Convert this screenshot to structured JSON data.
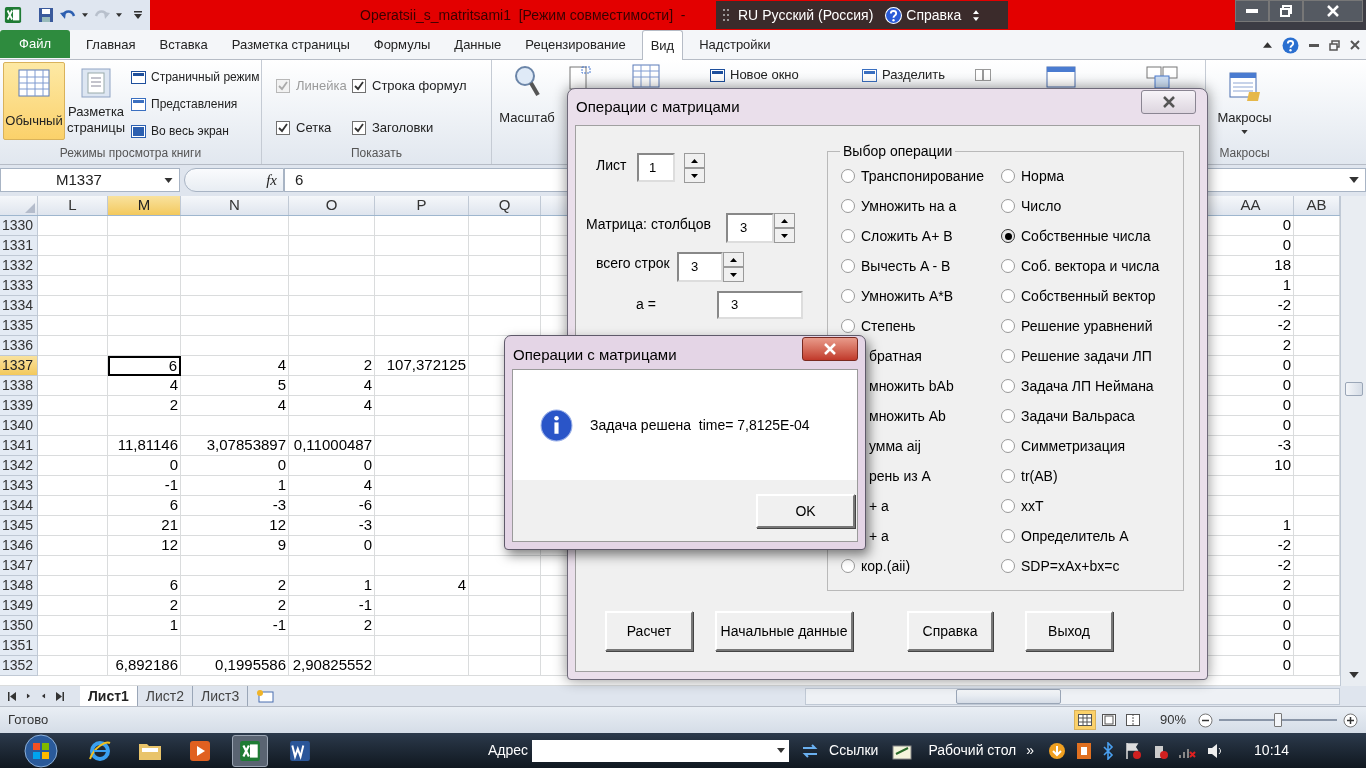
{
  "title_bar": {
    "title": "Operatsii_s_matritsami1  [Режим совместимости]  -",
    "language_bar": {
      "code": "RU",
      "language": "Русский (Россия)",
      "help": "Справка"
    }
  },
  "ribbon_tabs": [
    {
      "label": "Файл",
      "selected": false,
      "kind": "file"
    },
    {
      "label": "Главная",
      "selected": false,
      "kind": "tab"
    },
    {
      "label": "Вставка",
      "selected": false,
      "kind": "tab"
    },
    {
      "label": "Разметка страницы",
      "selected": false,
      "kind": "tab"
    },
    {
      "label": "Формулы",
      "selected": false,
      "kind": "tab"
    },
    {
      "label": "Данные",
      "selected": false,
      "kind": "tab"
    },
    {
      "label": "Рецензирование",
      "selected": false,
      "kind": "tab"
    },
    {
      "label": "Вид",
      "selected": true,
      "kind": "tab"
    },
    {
      "label": "Надстройки",
      "selected": false,
      "kind": "tab"
    }
  ],
  "ribbon": {
    "view_modes": {
      "caption": "Режимы просмотра книги",
      "large": [
        {
          "label": "Обычный",
          "selected": true
        },
        {
          "label": "Разметка страницы",
          "selected": false
        }
      ],
      "small": [
        "Страничный режим",
        "Представления",
        "Во весь экран"
      ]
    },
    "show": {
      "caption": "Показать",
      "checks": [
        {
          "label": "Линейка",
          "checked": true,
          "disabled": true
        },
        {
          "label": "Строка формул",
          "checked": true,
          "disabled": false
        },
        {
          "label": "Сетка",
          "checked": true,
          "disabled": false
        },
        {
          "label": "Заголовки",
          "checked": true,
          "disabled": false
        }
      ]
    },
    "zoom": {
      "label": "Масштаб"
    },
    "window": {
      "small": [
        "Новое окно",
        "Разделить"
      ]
    },
    "macros": {
      "label": "Макросы",
      "caption": "Макросы"
    }
  },
  "formula_bar": {
    "name_box": "M1337",
    "function_label": "fx",
    "value": "6"
  },
  "sheet": {
    "columns": [
      {
        "label": "L",
        "selected": false
      },
      {
        "label": "M",
        "selected": true
      },
      {
        "label": "N",
        "selected": false
      },
      {
        "label": "O",
        "selected": false
      },
      {
        "label": "P",
        "selected": false
      },
      {
        "label": "Q",
        "selected": false
      },
      {
        "label": "AA",
        "selected": false
      },
      {
        "label": "AB",
        "selected": false
      }
    ],
    "rows": [
      {
        "number": "1330",
        "selected": false,
        "cells": [
          null,
          null,
          null,
          null,
          null,
          null,
          "0",
          null
        ]
      },
      {
        "number": "1331",
        "selected": false,
        "cells": [
          null,
          null,
          null,
          null,
          null,
          null,
          "0",
          null
        ]
      },
      {
        "number": "1332",
        "selected": false,
        "cells": [
          null,
          null,
          null,
          null,
          null,
          null,
          "18",
          null
        ]
      },
      {
        "number": "1333",
        "selected": false,
        "cells": [
          null,
          null,
          null,
          null,
          null,
          null,
          "1",
          null
        ]
      },
      {
        "number": "1334",
        "selected": false,
        "cells": [
          null,
          null,
          null,
          null,
          null,
          null,
          "-2",
          null
        ]
      },
      {
        "number": "1335",
        "selected": false,
        "cells": [
          null,
          null,
          null,
          null,
          null,
          null,
          "-2",
          null
        ]
      },
      {
        "number": "1336",
        "selected": false,
        "cells": [
          null,
          null,
          null,
          null,
          null,
          null,
          "2",
          null
        ]
      },
      {
        "number": "1337",
        "selected": true,
        "cells": [
          null,
          "6",
          "4",
          "2",
          "107,372125",
          null,
          "0",
          null
        ]
      },
      {
        "number": "1338",
        "selected": false,
        "cells": [
          null,
          "4",
          "5",
          "4",
          null,
          null,
          "0",
          null
        ]
      },
      {
        "number": "1339",
        "selected": false,
        "cells": [
          null,
          "2",
          "4",
          "4",
          null,
          null,
          "0",
          null
        ]
      },
      {
        "number": "1340",
        "selected": false,
        "cells": [
          null,
          null,
          null,
          null,
          null,
          null,
          "0",
          null
        ]
      },
      {
        "number": "1341",
        "selected": false,
        "cells": [
          null,
          "11,81146",
          "3,07853897",
          "0,11000487",
          null,
          null,
          "-3",
          null
        ]
      },
      {
        "number": "1342",
        "selected": false,
        "cells": [
          null,
          "0",
          "0",
          "0",
          null,
          null,
          "10",
          null
        ]
      },
      {
        "number": "1343",
        "selected": false,
        "cells": [
          null,
          "-1",
          "1",
          "4",
          null,
          null,
          null,
          null
        ]
      },
      {
        "number": "1344",
        "selected": false,
        "cells": [
          null,
          "6",
          "-3",
          "-6",
          null,
          null,
          null,
          null
        ]
      },
      {
        "number": "1345",
        "selected": false,
        "cells": [
          null,
          "21",
          "12",
          "-3",
          null,
          null,
          "1",
          null
        ]
      },
      {
        "number": "1346",
        "selected": false,
        "cells": [
          null,
          "12",
          "9",
          "0",
          null,
          null,
          "-2",
          null
        ]
      },
      {
        "number": "1347",
        "selected": false,
        "cells": [
          null,
          null,
          null,
          null,
          null,
          null,
          "-2",
          null
        ]
      },
      {
        "number": "1348",
        "selected": false,
        "cells": [
          null,
          "6",
          "2",
          "1",
          "4",
          null,
          "2",
          null
        ]
      },
      {
        "number": "1349",
        "selected": false,
        "cells": [
          null,
          "2",
          "2",
          "-1",
          null,
          null,
          "0",
          null
        ]
      },
      {
        "number": "1350",
        "selected": false,
        "cells": [
          null,
          "1",
          "-1",
          "2",
          null,
          null,
          "0",
          null
        ]
      },
      {
        "number": "1351",
        "selected": false,
        "cells": [
          null,
          null,
          null,
          null,
          null,
          null,
          "0",
          null
        ]
      },
      {
        "number": "1352",
        "selected": false,
        "cells": [
          null,
          "6,892186",
          "0,1995586",
          "2,90825552",
          null,
          null,
          "0",
          null
        ]
      }
    ]
  },
  "sheet_tabs": [
    {
      "label": "Лист1",
      "selected": true
    },
    {
      "label": "Лист2",
      "selected": false
    },
    {
      "label": "Лист3",
      "selected": false
    }
  ],
  "status_bar": {
    "text": "Готово",
    "view_buttons": [
      {
        "selected": true
      },
      {
        "selected": false
      },
      {
        "selected": false
      }
    ],
    "zoom": "90%",
    "zoom_slider": {
      "level": 0.5
    }
  },
  "dialog": {
    "title": "Операции с матрицами",
    "sheet": {
      "label": "Лист",
      "value": "1"
    },
    "columns": {
      "label": "Матрица: столбцов",
      "value": "3"
    },
    "rows": {
      "label": "всего строк",
      "value": "3"
    },
    "scalar": {
      "label": "a =",
      "value": "3"
    },
    "operations": {
      "title": "Выбор операции",
      "columns": [
        [
          {
            "kind": "radio",
            "label": "Транспонирование",
            "selected": false
          },
          {
            "kind": "radio",
            "label": "Умножить на a",
            "selected": false
          },
          {
            "kind": "radio",
            "label": "Сложить A+ B",
            "selected": false
          },
          {
            "kind": "radio",
            "label": "Вычесть A - B",
            "selected": false
          },
          {
            "kind": "radio",
            "label": "Умножить A*B",
            "selected": false
          },
          {
            "kind": "radio",
            "label": "Степень",
            "selected": false
          },
          {
            "kind": "text",
            "label": "братная"
          },
          {
            "kind": "text",
            "label": "множить bAb"
          },
          {
            "kind": "text",
            "label": "множить Ab"
          },
          {
            "kind": "text",
            "label": "умма aij"
          },
          {
            "kind": "text",
            "label": "рень из A"
          },
          {
            "kind": "text",
            "label": "+ a"
          },
          {
            "kind": "text",
            "label": "+ a"
          },
          {
            "kind": "radio",
            "label": "кор.(aii)",
            "selected": false
          }
        ],
        [
          {
            "kind": "radio",
            "label": "Норма",
            "selected": false
          },
          {
            "kind": "radio",
            "label": "Число",
            "selected": false
          },
          {
            "kind": "radio",
            "label": "Собственные числа",
            "selected": true
          },
          {
            "kind": "radio",
            "label": "Соб. вектора и числа",
            "selected": false
          },
          {
            "kind": "radio",
            "label": "Собственный вектор",
            "selected": false
          },
          {
            "kind": "radio",
            "label": "Решение уравнений",
            "selected": false
          },
          {
            "kind": "radio",
            "label": "Решение задачи ЛП",
            "selected": false
          },
          {
            "kind": "radio",
            "label": "Задача ЛП Неймана",
            "selected": false
          },
          {
            "kind": "radio",
            "label": "Задачи Вальраса",
            "selected": false
          },
          {
            "kind": "radio",
            "label": "Симметризация",
            "selected": false
          },
          {
            "kind": "radio",
            "label": "tr(AB)",
            "selected": false
          },
          {
            "kind": "radio",
            "label": "xxT",
            "selected": false
          },
          {
            "kind": "radio",
            "label": "Определитель A",
            "selected": false
          },
          {
            "kind": "radio",
            "label": "SDP=xAx+bx=c",
            "selected": false
          }
        ]
      ]
    },
    "buttons": [
      "Расчет",
      "Начальные данные",
      "Справка",
      "Выход"
    ]
  },
  "message_box": {
    "title": "Операции с матрицами",
    "text": "Задача решена  time= 7,8125E-04",
    "button": "OK"
  },
  "taskbar": {
    "apps": [
      {
        "kind": "ie",
        "selected": false
      },
      {
        "kind": "folder",
        "selected": false
      },
      {
        "kind": "media",
        "selected": false
      },
      {
        "kind": "excel",
        "selected": true
      },
      {
        "kind": "word",
        "selected": false
      }
    ],
    "address_label": "Адрес",
    "links": "Ссылки",
    "desktop": "Рабочий стол",
    "more": "»",
    "clock": "10:14"
  }
}
